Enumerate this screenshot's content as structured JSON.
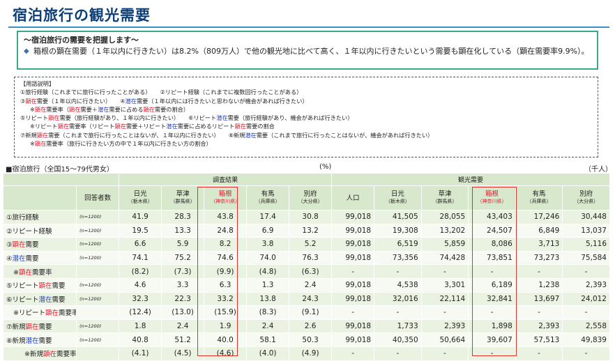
{
  "title": "宿泊旅行の観光需要",
  "summary": {
    "heading": "～宿泊旅行の需要を把握します～",
    "text": "箱根の顕在需要（１年以内に行きたい）は8.2%（809万人）で他の観光地に比べて高く、１年以内に行きたいという需要も顕在化している（顕在需要率9.9%）。"
  },
  "terms": {
    "header": "【用語説明】",
    "line1a": "①旅行経験（これまでに旅行に行ったことがある）",
    "line1b": "②リピート経験（これまでに複数回行ったことがある）",
    "line2a_pre": "③",
    "line2a_kw": "顕在",
    "line2a_post": "需要（１年以内に行きたい）",
    "line2b_pre": "④",
    "line2b_kw": "潜在",
    "line2b_post": "需要（１年以内には行きたいと思わないが機会があれば行きたい）",
    "line3_pre": "※",
    "line3_kw1": "顕在",
    "line3_mid1": "需要率（",
    "line3_kw2": "顕在",
    "line3_mid2": "需要＋",
    "line3_kw3": "潜在",
    "line3_mid3": "需要に占める",
    "line3_kw4": "顕在",
    "line3_post": "需要の割合）",
    "line4a_pre": "⑤リピート",
    "line4a_kw": "顕在",
    "line4a_post": "需要（旅行経験があり、１年以内に行きたい）",
    "line4b_pre": "⑥リピート",
    "line4b_kw": "潜在",
    "line4b_post": "需要（旅行経験があり、機会があれば行きたい）",
    "line5_pre": "※リピート",
    "line5_kw1": "顕在",
    "line5_mid1": "需要率（リピート",
    "line5_kw2": "顕在",
    "line5_mid2": "需要＋リピート",
    "line5_kw3": "潜在",
    "line5_mid3": "需要に占めるリピート",
    "line5_kw4": "顕在",
    "line5_post": "需要の割合",
    "line6a_pre": "⑦新規",
    "line6a_kw": "顕在",
    "line6a_post": "需要（これまで旅行に行ったことはないが、１年以内に行きたい）",
    "line6b_pre": "⑧新規",
    "line6b_kw": "潜在",
    "line6b_post": "需要（これまで旅行に行ったことはないが、機会があれば行きたい）",
    "line7_pre": "※",
    "line7_kw": "顕在",
    "line7_post": "需要率（旅行に行きたい方の中で１年以内に行きたい方の割合）"
  },
  "captions": {
    "left": "■宿泊旅行（全国15～79代男女）",
    "unit_pct": "(%)",
    "unit_k": "（千人）"
  },
  "headers": {
    "group1": "調査結果",
    "group2": "観光需要",
    "respondents": "回答者数",
    "population": "人口",
    "places": [
      {
        "name": "日光",
        "pref": "（栃木県）"
      },
      {
        "name": "草津",
        "pref": "（群馬県）"
      },
      {
        "name": "箱根",
        "pref": "（神奈川県）"
      },
      {
        "name": "有馬",
        "pref": "（兵庫県）"
      },
      {
        "name": "別府",
        "pref": "（大分県）"
      }
    ]
  },
  "rows": [
    {
      "pre": "①旅行経験",
      "n": "(n=1200)",
      "pct": [
        "41.9",
        "28.3",
        "43.8",
        "17.4",
        "30.8"
      ],
      "pop": "99,018",
      "k": [
        "41,505",
        "28,055",
        "43,403",
        "17,246",
        "30,448"
      ]
    },
    {
      "pre": "②リピート経験",
      "n": "(n=1200)",
      "pct": [
        "19.5",
        "13.3",
        "24.8",
        "6.9",
        "13.2"
      ],
      "pop": "99,018",
      "k": [
        "19,308",
        "13,202",
        "24,507",
        "6,849",
        "13,037"
      ]
    },
    {
      "pre": "③",
      "kw": "顕在",
      "kwc": "red",
      "post": "需要",
      "n": "(n=1200)",
      "pct": [
        "6.6",
        "5.9",
        "8.2",
        "3.8",
        "5.2"
      ],
      "pop": "99,018",
      "k": [
        "6,519",
        "5,859",
        "8,086",
        "3,713",
        "5,116"
      ]
    },
    {
      "pre": "④",
      "kw": "潜在",
      "kwc": "blue",
      "post": "需要",
      "n": "(n=1200)",
      "pct": [
        "74.1",
        "75.2",
        "74.6",
        "74.0",
        "76.3"
      ],
      "pop": "99,018",
      "k": [
        "73,356",
        "74,428",
        "73,851",
        "73,273",
        "75,584"
      ]
    },
    {
      "pre": "※",
      "kw": "顕在",
      "kwc": "red",
      "post": "需要率",
      "n": "",
      "pct": [
        "(8.2)",
        "(7.3)",
        "(9.9)",
        "(4.8)",
        "(6.3)"
      ],
      "pop": "-",
      "k": [
        "-",
        "-",
        "-",
        "-",
        "-"
      ]
    },
    {
      "pre": "⑤リピート",
      "kw": "顕在",
      "kwc": "red",
      "post": "需要",
      "n": "(n=1200)",
      "pct": [
        "4.6",
        "3.3",
        "6.3",
        "1.3",
        "2.4"
      ],
      "pop": "99,018",
      "k": [
        "4,538",
        "3,301",
        "6,189",
        "1,238",
        "2,393"
      ]
    },
    {
      "pre": "⑥リピート",
      "kw": "潜在",
      "kwc": "blue",
      "post": "需要",
      "n": "(n=1200)",
      "pct": [
        "32.3",
        "22.3",
        "33.2",
        "13.8",
        "24.3"
      ],
      "pop": "99,018",
      "k": [
        "32,016",
        "22,114",
        "32,841",
        "13,697",
        "24,012"
      ]
    },
    {
      "pre": "※リピート",
      "kw": "顕在",
      "kwc": "red",
      "post": "需要率",
      "n": "",
      "pct": [
        "(12.4)",
        "(13.0)",
        "(15.9)",
        "(8.3)",
        "(9.1)"
      ],
      "pop": "-",
      "k": [
        "-",
        "-",
        "-",
        "-",
        "-"
      ]
    },
    {
      "pre": "⑦新規",
      "kw": "顕在",
      "kwc": "red",
      "post": "需要",
      "n": "(n=1200)",
      "pct": [
        "1.8",
        "2.4",
        "1.9",
        "2.4",
        "2.6"
      ],
      "pop": "99,018",
      "k": [
        "1,733",
        "2,393",
        "1,898",
        "2,393",
        "2,558"
      ]
    },
    {
      "pre": "⑧新規",
      "kw": "潜在",
      "kwc": "blue",
      "post": "需要",
      "n": "(n=1200)",
      "pct": [
        "40.8",
        "51.2",
        "40.0",
        "58.1",
        "50.3"
      ],
      "pop": "99,018",
      "k": [
        "40,350",
        "50,664",
        "39,607",
        "57,513",
        "49,839"
      ]
    },
    {
      "pre": "※新規",
      "kw": "顕在",
      "kwc": "red",
      "post": "需要率",
      "n": "",
      "pct": [
        "(4.1)",
        "(4.5)",
        "(4.6)",
        "(4.0)",
        "(4.9)"
      ],
      "pop": "-",
      "k": [
        "-",
        "-",
        "-",
        "-",
        "-"
      ]
    }
  ],
  "colors": {
    "accent_red": "#e8182c",
    "accent_blue": "#1f3fbf",
    "header_green": "#d8e8cc",
    "frame_teal": "#39a98a"
  }
}
